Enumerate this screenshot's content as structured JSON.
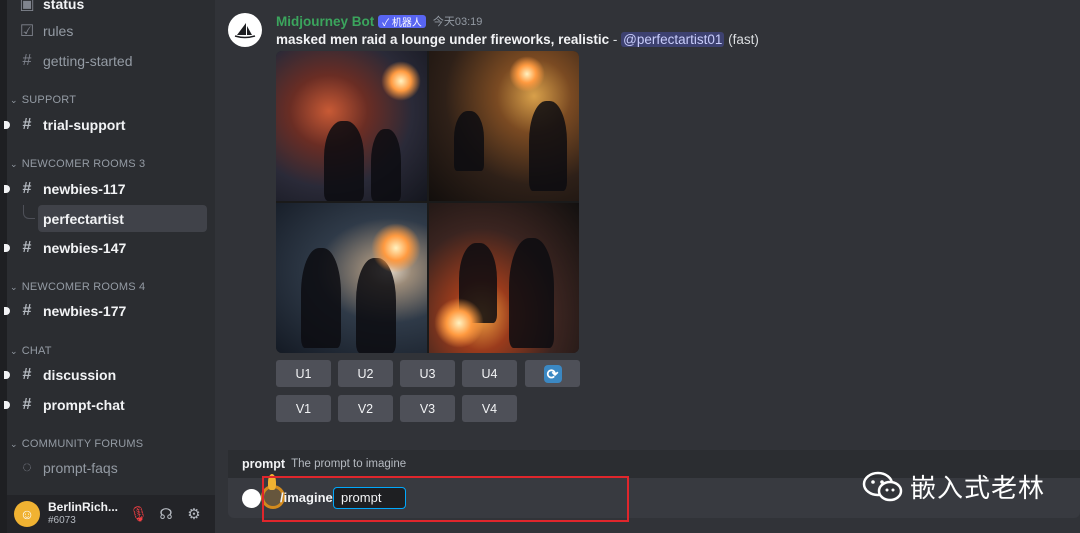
{
  "sidebar": {
    "channels_top": [
      {
        "label": "status",
        "icon": "forum-icon"
      },
      {
        "label": "rules",
        "icon": "check-square-icon"
      },
      {
        "label": "getting-started",
        "icon": "hash-icon"
      }
    ],
    "categories": {
      "support": "SUPPORT",
      "newcomer3": "NEWCOMER ROOMS 3",
      "newcomer4": "NEWCOMER ROOMS 4",
      "chat": "CHAT",
      "forums": "COMMUNITY FORUMS"
    },
    "channels": {
      "trial_support": "trial-support",
      "newbies117": "newbies-117",
      "thread": "perfectartist",
      "newbies147": "newbies-147",
      "newbies177": "newbies-177",
      "discussion": "discussion",
      "prompt_chat": "prompt-chat",
      "prompt_faqs": "prompt-faqs"
    },
    "user": {
      "name": "BerlinRich...",
      "tag": "#6073"
    }
  },
  "message": {
    "author": "Midjourney Bot",
    "bot_tag": "✓ 机器人",
    "timestamp": "今天03:19",
    "prompt": "masked men raid a lounge under fireworks, realistic",
    "separator": " - ",
    "mention": "@perfectartist01",
    "speed": " (fast)"
  },
  "buttons": {
    "upscale": [
      "U1",
      "U2",
      "U3",
      "U4"
    ],
    "variation": [
      "V1",
      "V2",
      "V3",
      "V4"
    ],
    "reroll_icon": "refresh-icon"
  },
  "composer": {
    "hint_key": "prompt",
    "hint_desc": "The prompt to imagine",
    "command": "/imagine",
    "option": "prompt"
  },
  "watermark": {
    "text": "嵌入式老林"
  },
  "colors": {
    "accent": "#5865f2",
    "author": "#3ba55d",
    "highlight_box": "#e0262c",
    "input_focus": "#00a8fc"
  }
}
